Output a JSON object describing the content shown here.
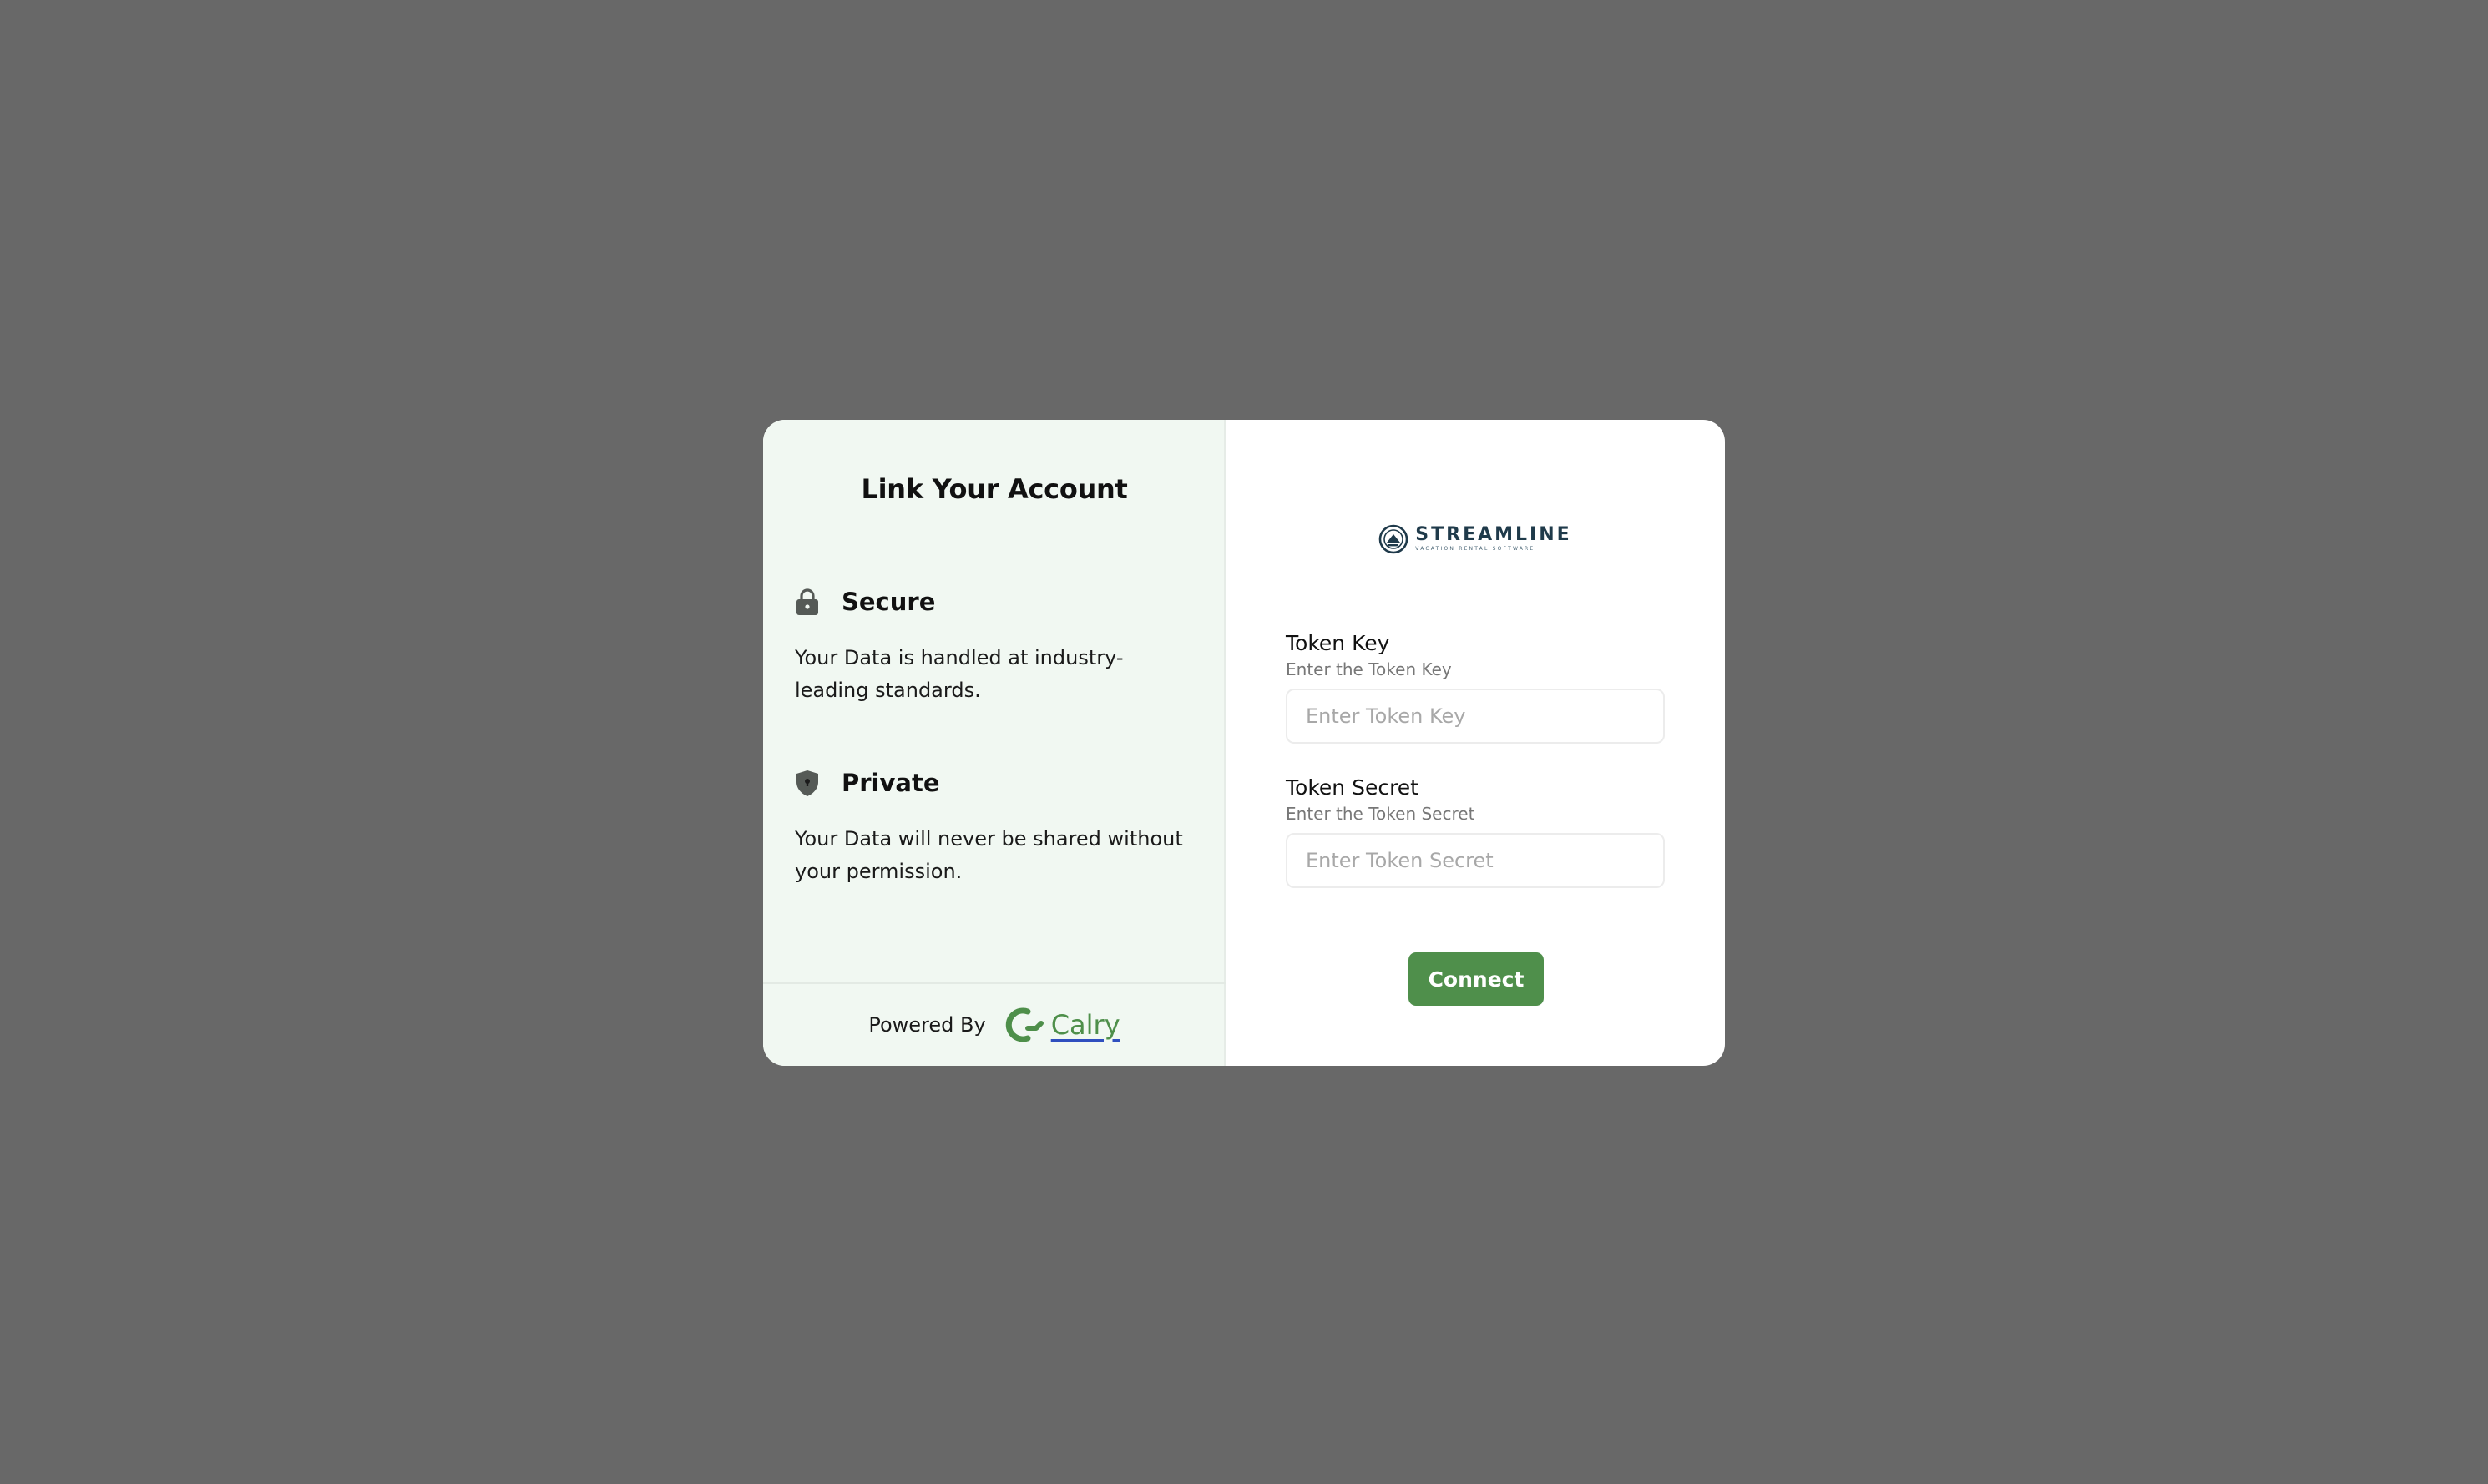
{
  "modal": {
    "title": "Link Your Account",
    "features": [
      {
        "icon": "lock-icon",
        "title": "Secure",
        "text": "Your Data is handled at industry-leading standards."
      },
      {
        "icon": "shield-icon",
        "title": "Private",
        "text": "Your Data will never be shared without your permission."
      }
    ],
    "footer": {
      "powered_by": "Powered By",
      "brand": "Calry"
    }
  },
  "integration": {
    "logo_name": "STREAMLINE",
    "logo_tagline": "VACATION RENTAL SOFTWARE",
    "fields": [
      {
        "label": "Token Key",
        "hint": "Enter the Token Key",
        "placeholder": "Enter Token Key",
        "value": ""
      },
      {
        "label": "Token Secret",
        "hint": "Enter the Token Secret",
        "placeholder": "Enter Token Secret",
        "value": ""
      }
    ],
    "submit_label": "Connect"
  },
  "colors": {
    "backdrop": "#686868",
    "left_panel": "#f1f8f2",
    "accent": "#4f8f4b",
    "brand_navy": "#1f3a4a"
  }
}
